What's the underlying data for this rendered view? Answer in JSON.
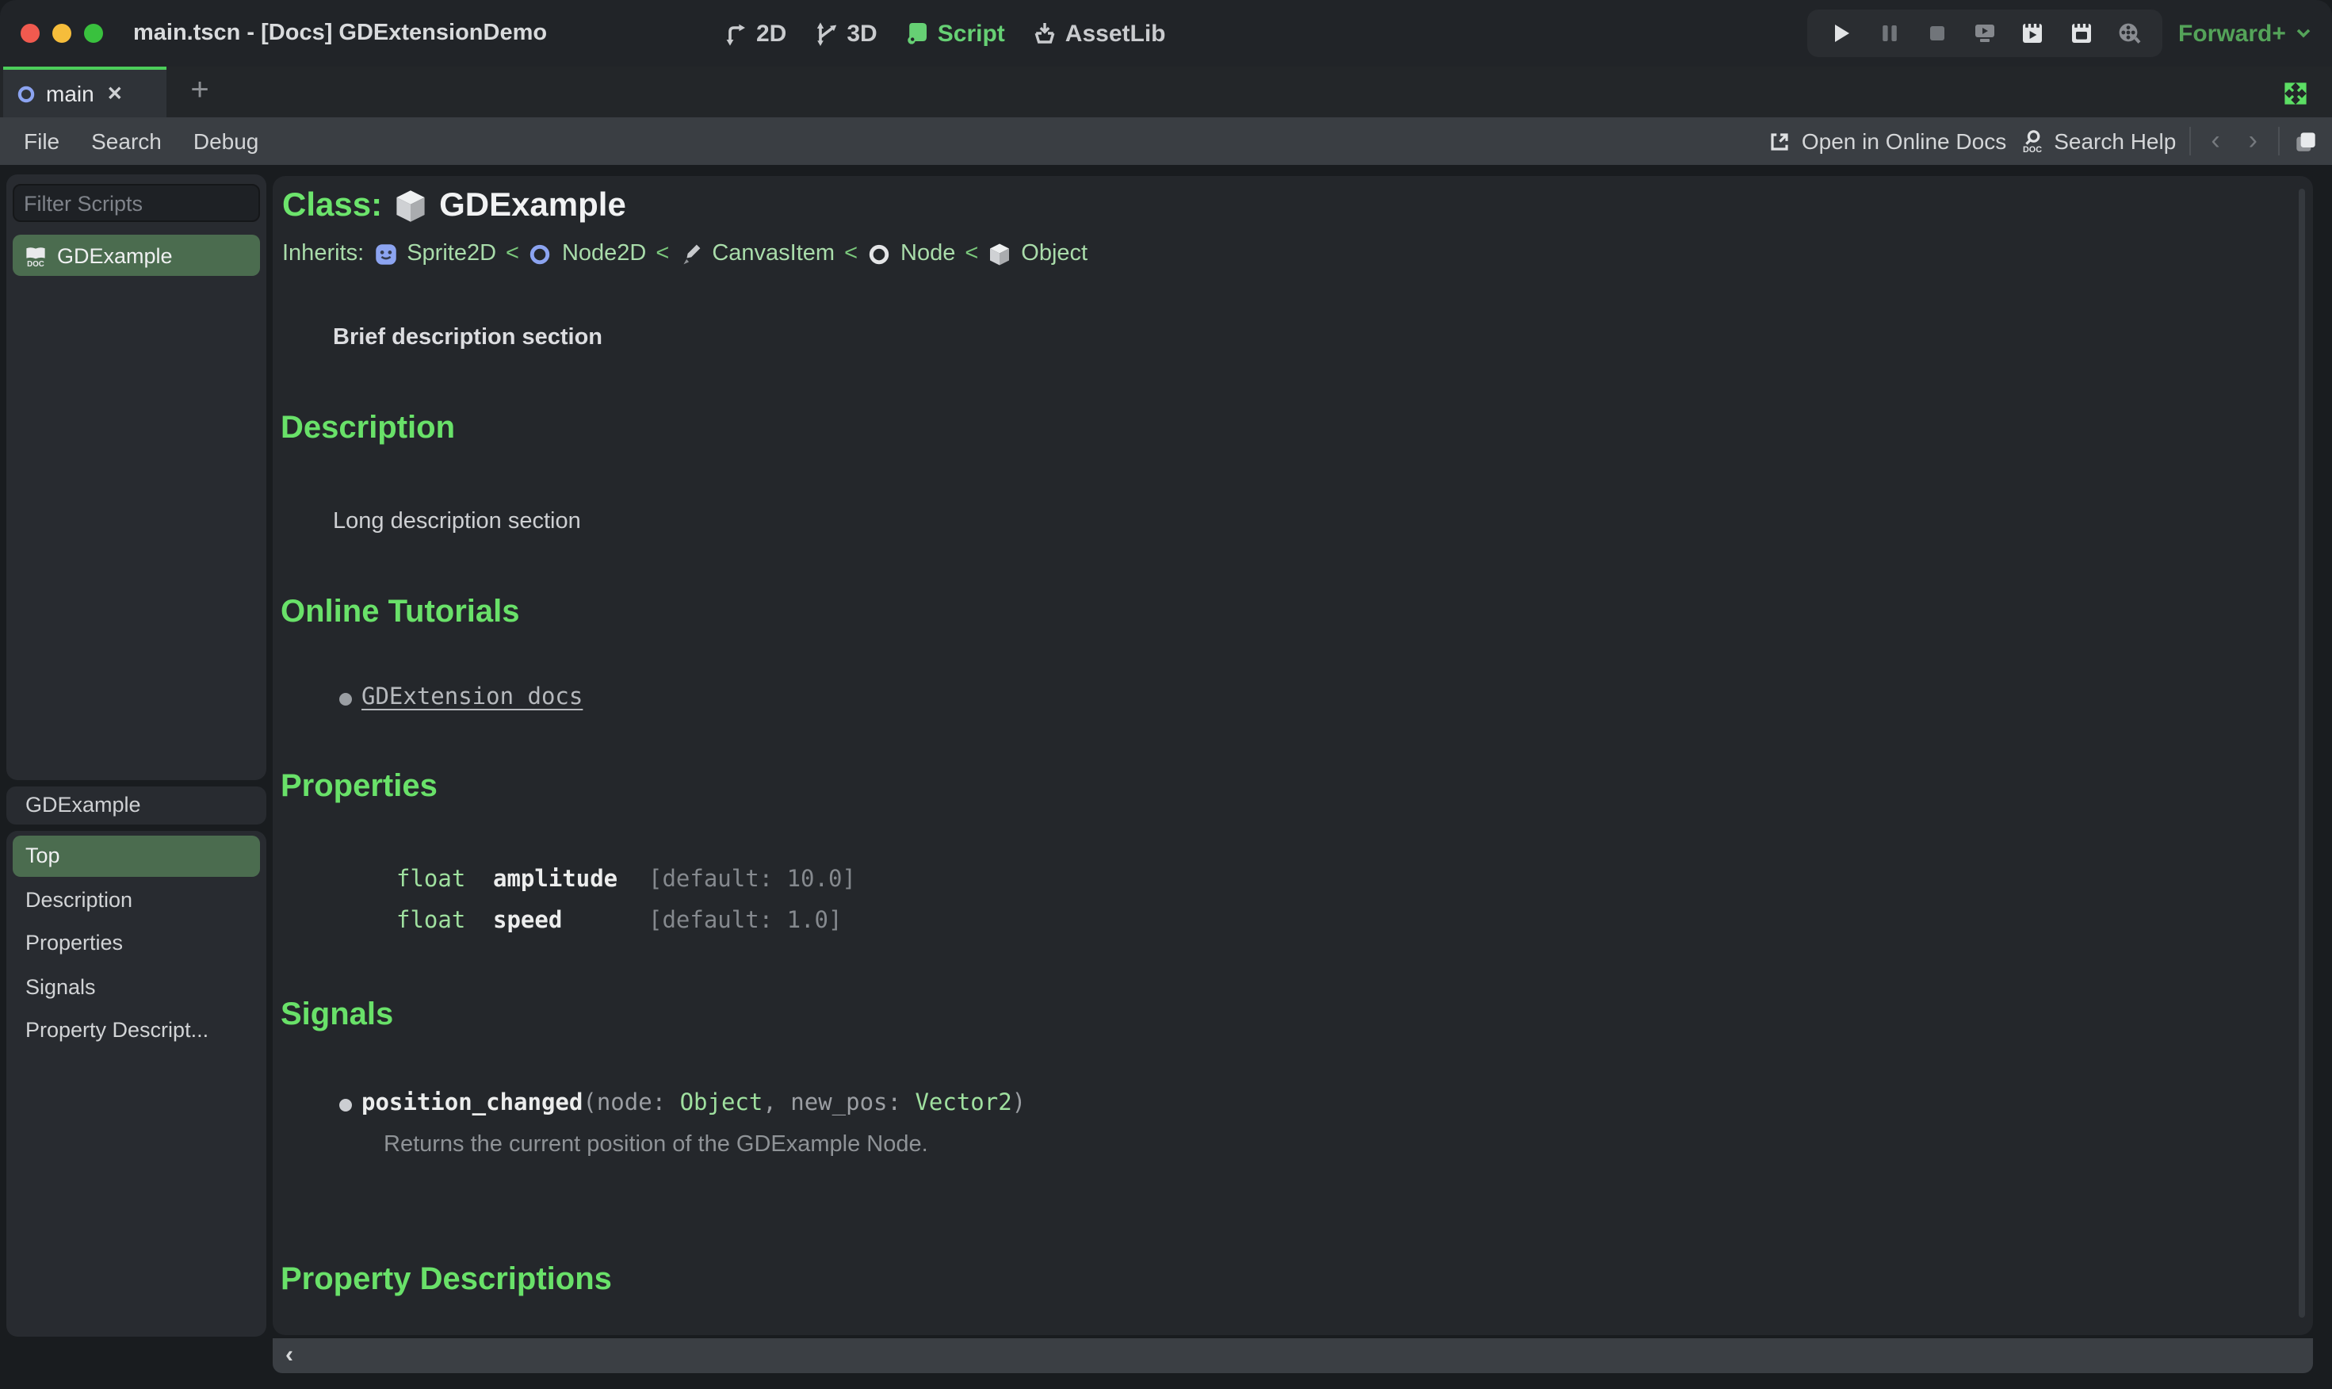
{
  "window": {
    "title": "main.tscn - [Docs] GDExtensionDemo"
  },
  "titlebar": {
    "switcher": {
      "items": [
        {
          "label": "2D"
        },
        {
          "label": "3D"
        },
        {
          "label": "Script"
        },
        {
          "label": "AssetLib"
        }
      ],
      "active": "Script"
    },
    "playback_buttons": [
      "play",
      "pause",
      "stop",
      "play-scene",
      "play-current-scene",
      "play-custom-scene",
      "movie-maker"
    ],
    "renderer": {
      "label": "Forward+"
    }
  },
  "tabbar": {
    "tabs": [
      {
        "label": "main",
        "active": true
      }
    ],
    "new_tab_glyph": "+"
  },
  "menubar": {
    "items": [
      {
        "label": "File"
      },
      {
        "label": "Search"
      },
      {
        "label": "Debug"
      }
    ],
    "open_online_docs": "Open in Online Docs",
    "search_help": "Search Help"
  },
  "scripts_panel": {
    "filter_placeholder": "Filter Scripts",
    "items": [
      {
        "label": "GDExample",
        "selected": true
      }
    ]
  },
  "outline_panel": {
    "header": "GDExample",
    "items": [
      {
        "label": "Top",
        "selected": true
      },
      {
        "label": "Description"
      },
      {
        "label": "Properties"
      },
      {
        "label": "Signals"
      },
      {
        "label": "Property Descript..."
      }
    ]
  },
  "doc": {
    "class_label": "Class:",
    "class_name": "GDExample",
    "inherits_label": "Inherits:",
    "separator": "<",
    "inherits": [
      {
        "name": "Sprite2D"
      },
      {
        "name": "Node2D"
      },
      {
        "name": "CanvasItem"
      },
      {
        "name": "Node"
      },
      {
        "name": "Object"
      }
    ],
    "brief": "Brief description section",
    "description": {
      "heading": "Description",
      "body": "Long description section"
    },
    "tutorials": {
      "heading": "Online Tutorials",
      "links": [
        {
          "label": "GDExtension docs"
        }
      ]
    },
    "properties": {
      "heading": "Properties",
      "rows": [
        {
          "type": "float",
          "name": "amplitude",
          "default": "[default: 10.0]"
        },
        {
          "type": "float",
          "name": "speed",
          "default": "[default: 1.0]"
        }
      ]
    },
    "signals": {
      "heading": "Signals",
      "items": [
        {
          "name": "position_changed",
          "sig_open": "(node: ",
          "param1_type": "Object",
          "sig_mid": ", new_pos: ",
          "param2_type": "Vector2",
          "sig_close": ")",
          "description": "Returns the current position of the GDExample Node."
        }
      ]
    },
    "property_descriptions": {
      "heading": "Property Descriptions"
    }
  },
  "colors": {
    "accent_green": "#6ce46c",
    "selected_item_green": "#4b6c4f",
    "script_tab_green": "#66d074",
    "renderer_green": "#54a359",
    "traffic_red": "#f05a4f",
    "traffic_yellow": "#f6bd3b",
    "traffic_green": "#39c13e"
  }
}
